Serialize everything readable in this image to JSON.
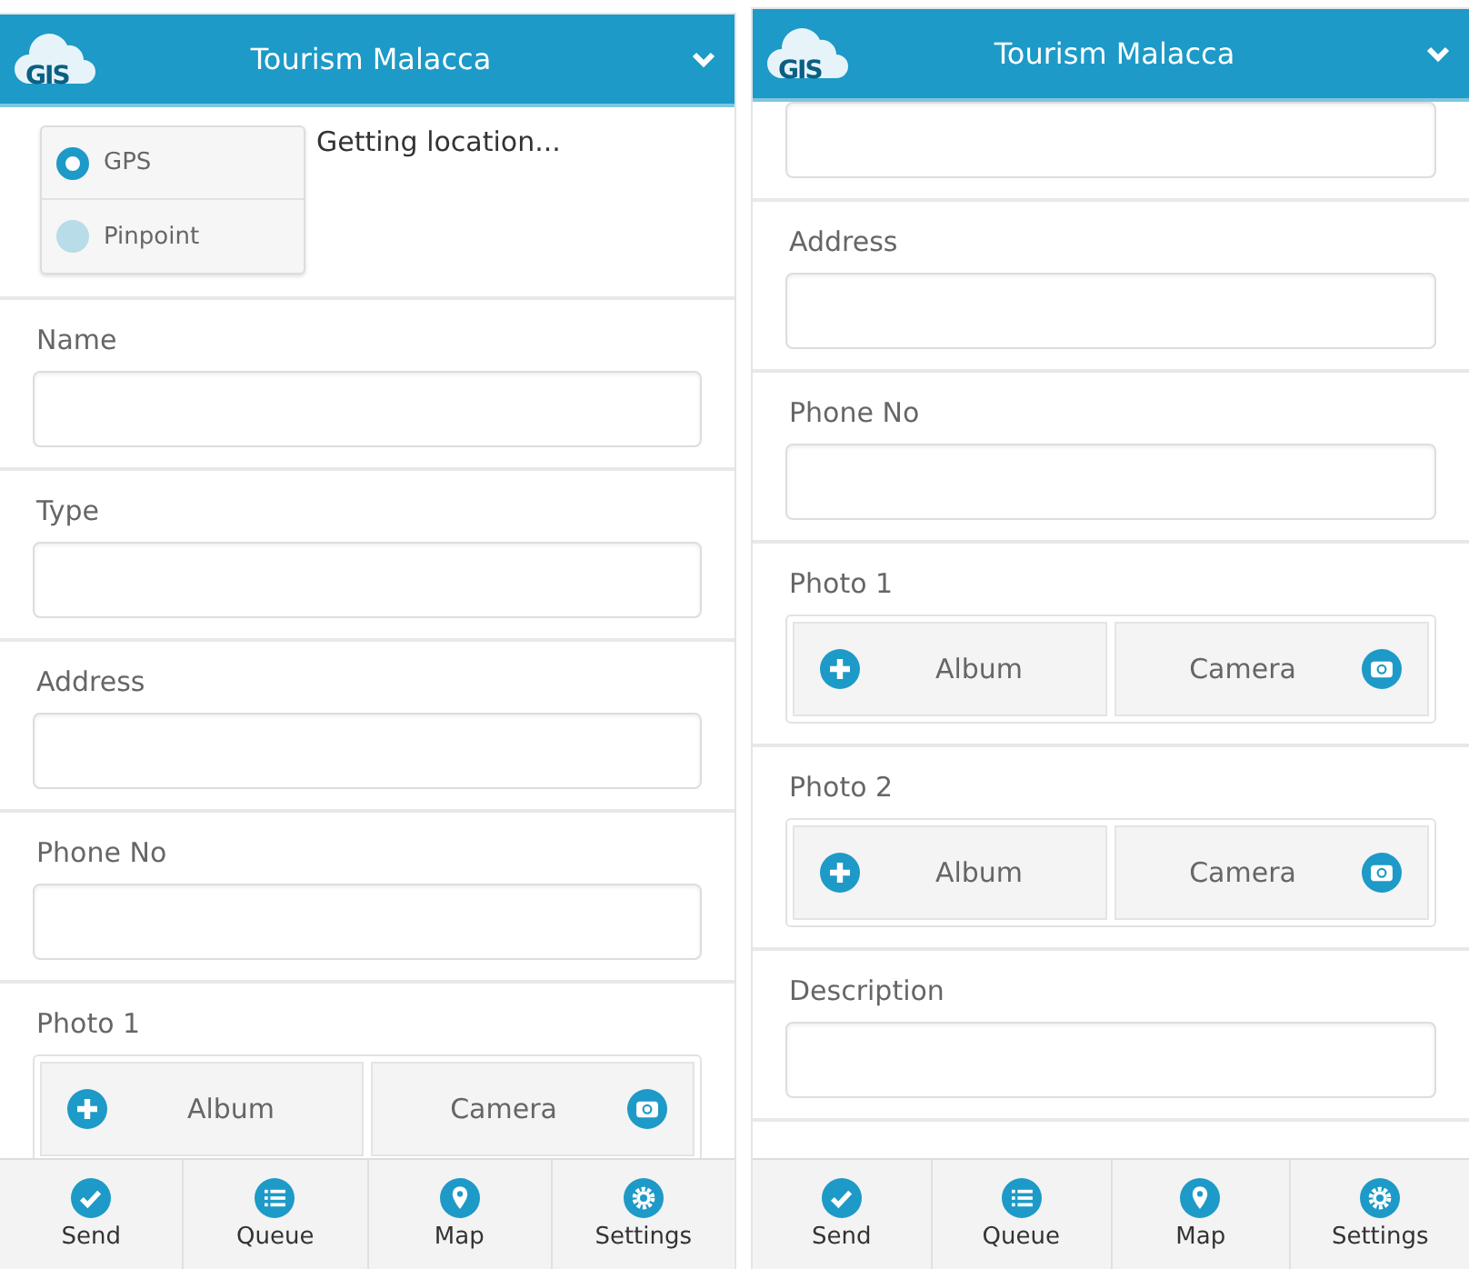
{
  "screens": [
    {
      "header": {
        "logo": "GIS",
        "title": "Tourism Malacca"
      },
      "location": {
        "options": [
          {
            "label": "GPS",
            "selected": true
          },
          {
            "label": "Pinpoint",
            "selected": false
          }
        ],
        "status": "Getting location..."
      },
      "sections": [
        {
          "kind": "text",
          "label": "Name"
        },
        {
          "kind": "text",
          "label": "Type"
        },
        {
          "kind": "text",
          "label": "Address"
        },
        {
          "kind": "text",
          "label": "Phone No"
        },
        {
          "kind": "photo",
          "label": "Photo 1",
          "buttons": [
            "Album",
            "Camera"
          ]
        }
      ],
      "nav": [
        "Send",
        "Queue",
        "Map",
        "Settings"
      ]
    },
    {
      "header": {
        "logo": "GIS",
        "title": "Tourism Malacca"
      },
      "sections": [
        {
          "kind": "field"
        },
        {
          "kind": "text",
          "label": "Address"
        },
        {
          "kind": "text",
          "label": "Phone No"
        },
        {
          "kind": "photo",
          "label": "Photo 1",
          "buttons": [
            "Album",
            "Camera"
          ]
        },
        {
          "kind": "photo",
          "label": "Photo 2",
          "buttons": [
            "Album",
            "Camera"
          ]
        },
        {
          "kind": "text",
          "label": "Description"
        }
      ],
      "nav": [
        "Send",
        "Queue",
        "Map",
        "Settings"
      ]
    }
  ]
}
